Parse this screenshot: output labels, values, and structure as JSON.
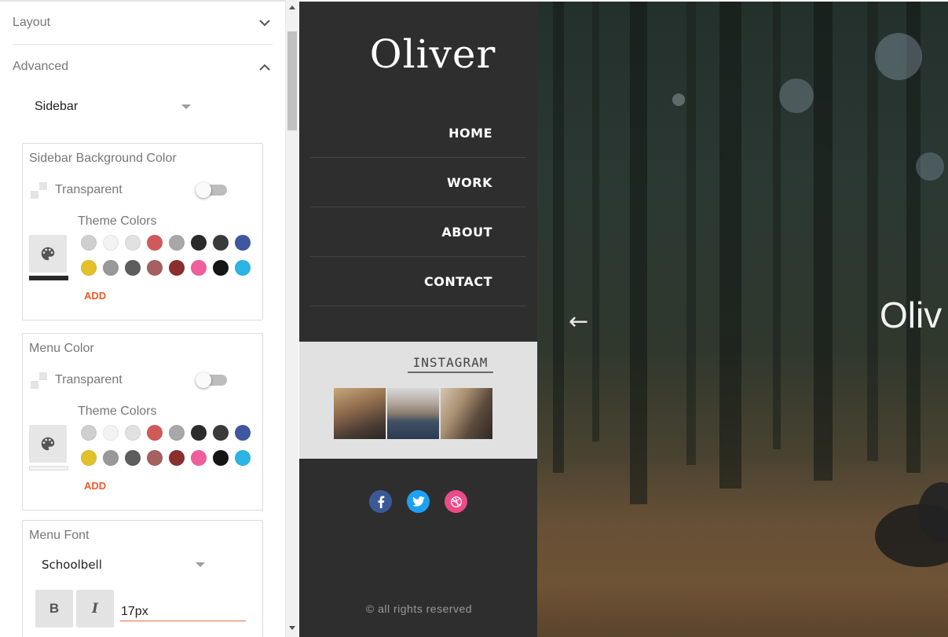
{
  "panel": {
    "sections": [
      {
        "label": "Layout",
        "expanded": false
      },
      {
        "label": "Advanced",
        "expanded": true
      }
    ],
    "advanced_select": "Sidebar",
    "sidebar_bg": {
      "title": "Sidebar Background Color",
      "transparent_label": "Transparent",
      "transparent_on": false,
      "theme_colors_label": "Theme Colors",
      "selected_color": "#2a2a2a",
      "add_label": "ADD"
    },
    "menu_color": {
      "title": "Menu Color",
      "transparent_label": "Transparent",
      "transparent_on": false,
      "theme_colors_label": "Theme Colors",
      "selected_color": "#f2f2f2",
      "add_label": "ADD"
    },
    "theme_colors": [
      "#cfcfcf",
      "#f3f3f3",
      "#e1e1e1",
      "#d05a5a",
      "#a8a8a8",
      "#2b2b2b",
      "#3a3a3a",
      "#3f57a0",
      "#e3c12a",
      "#999999",
      "#5d5d5d",
      "#a66060",
      "#8c2e2e",
      "#f05f9c",
      "#151515",
      "#2bb5e6"
    ],
    "menu_font": {
      "title": "Menu Font",
      "font": "Schoolbell",
      "bold_label": "B",
      "italic_label": "I",
      "size": "17px"
    }
  },
  "preview": {
    "site_title": "Oliver",
    "nav": [
      "HOME",
      "WORK",
      "ABOUT",
      "CONTACT"
    ],
    "instagram_title": "INSTAGRAM",
    "social": [
      "facebook-icon",
      "twitter-icon",
      "dribbble-icon"
    ],
    "social_colors": {
      "facebook": "#3b5998",
      "twitter": "#1da1f2",
      "dribbble": "#ea4c89"
    },
    "copyright": "© all rights reserved",
    "hero_title": "Oliv",
    "hero_arrow": "←"
  },
  "colors": {
    "accent": "#ef5a2a",
    "sidebar_bg": "#2e2e2e",
    "insta_bg": "#e1e1e1"
  }
}
